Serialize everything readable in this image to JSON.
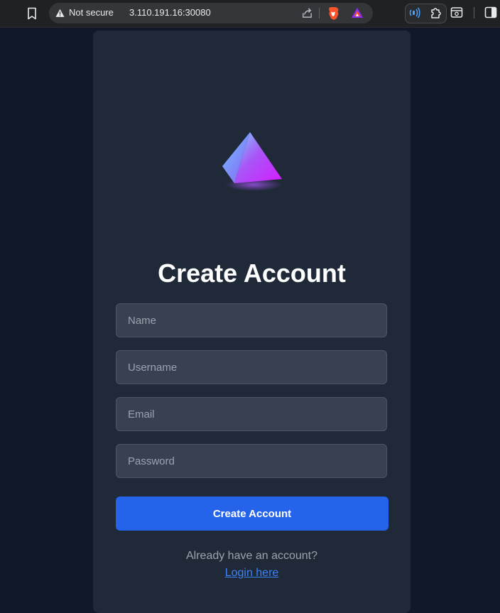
{
  "browser": {
    "security_label": "Not secure",
    "url": "3.110.191.16:30080"
  },
  "logo": {
    "gradient_from": "#6ec6ff",
    "gradient_to": "#d61cff",
    "glow": "#a855f7"
  },
  "form": {
    "title": "Create Account",
    "fields": [
      {
        "placeholder": "Name",
        "value": ""
      },
      {
        "placeholder": "Username",
        "value": ""
      },
      {
        "placeholder": "Email",
        "value": ""
      },
      {
        "placeholder": "Password",
        "value": ""
      }
    ],
    "submit_label": "Create Account",
    "login_prompt": "Already have an account?",
    "login_link": "Login here"
  },
  "colors": {
    "page_bg": "#111827",
    "card_bg": "#1f2937",
    "input_bg": "#374151",
    "button": "#2563eb",
    "link": "#3b82f6"
  }
}
